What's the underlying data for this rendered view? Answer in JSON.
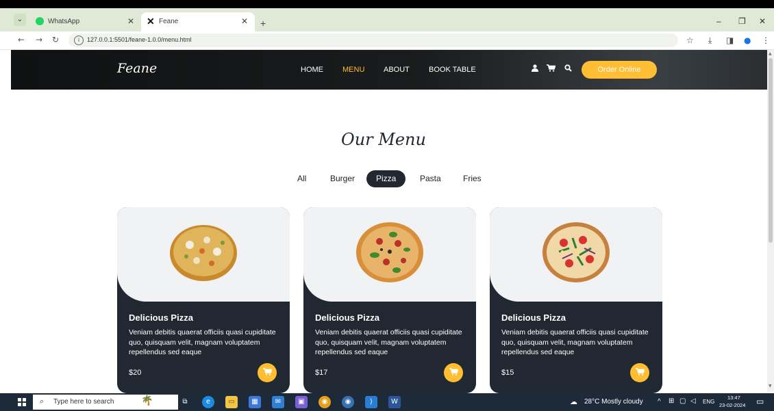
{
  "browser": {
    "tabs": [
      {
        "title": "WhatsApp",
        "active": false
      },
      {
        "title": "Feane",
        "active": true
      }
    ],
    "new_tab_icon": "+",
    "address": "127.0.0.1:5501/feane-1.0.0/menu.html"
  },
  "site": {
    "brand": "Feane",
    "nav": [
      "HOME",
      "MENU",
      "ABOUT",
      "BOOK TABLE"
    ],
    "active_nav": "MENU",
    "order_button": "Order Online",
    "accent_color": "#ffbe33",
    "dark_color": "#222831"
  },
  "menu": {
    "heading": "Our Menu",
    "filters": [
      "All",
      "Burger",
      "Pizza",
      "Pasta",
      "Fries"
    ],
    "active_filter": "Pizza",
    "items": [
      {
        "name": "Delicious Pizza",
        "description": "Veniam debitis quaerat officiis quasi cupiditate quo, quisquam velit, magnam voluptatem repellendus sed eaque",
        "price": "$20"
      },
      {
        "name": "Delicious Pizza",
        "description": "Veniam debitis quaerat officiis quasi cupiditate quo, quisquam velit, magnam voluptatem repellendus sed eaque",
        "price": "$17"
      },
      {
        "name": "Delicious Pizza",
        "description": "Veniam debitis quaerat officiis quasi cupiditate quo, quisquam velit, magnam voluptatem repellendus sed eaque",
        "price": "$15"
      }
    ]
  },
  "taskbar": {
    "search_placeholder": "Type here to search",
    "weather": "28°C  Mostly cloudy",
    "language": "ENG",
    "time": "13:47",
    "date": "23-02-2024"
  }
}
